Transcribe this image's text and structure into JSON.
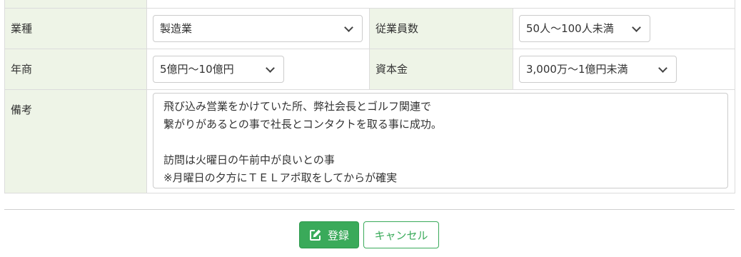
{
  "form": {
    "industry": {
      "label": "業種",
      "value": "製造業"
    },
    "employees": {
      "label": "従業員数",
      "value": "50人〜100人未満"
    },
    "revenue": {
      "label": "年商",
      "value": "5億円〜10億円"
    },
    "capital": {
      "label": "資本金",
      "value": "3,000万〜1億円未満"
    },
    "memo": {
      "label": "備考",
      "value": "飛び込み営業をかけていた所、弊社会長とゴルフ関連で\n繋がりがあるとの事で社長とコンタクトを取る事に成功。\n\n訪問は火曜日の午前中が良いとの事\n※月曜日の夕方にＴＥＬアポ取をしてからが確実"
    }
  },
  "actions": {
    "save_label": "登録",
    "cancel_label": "キャンセル"
  },
  "icons": {
    "save": "edit-icon",
    "dropdown": "chevron-down-icon"
  },
  "colors": {
    "label_bg": "#eef4e7",
    "primary": "#3aaa5a"
  }
}
